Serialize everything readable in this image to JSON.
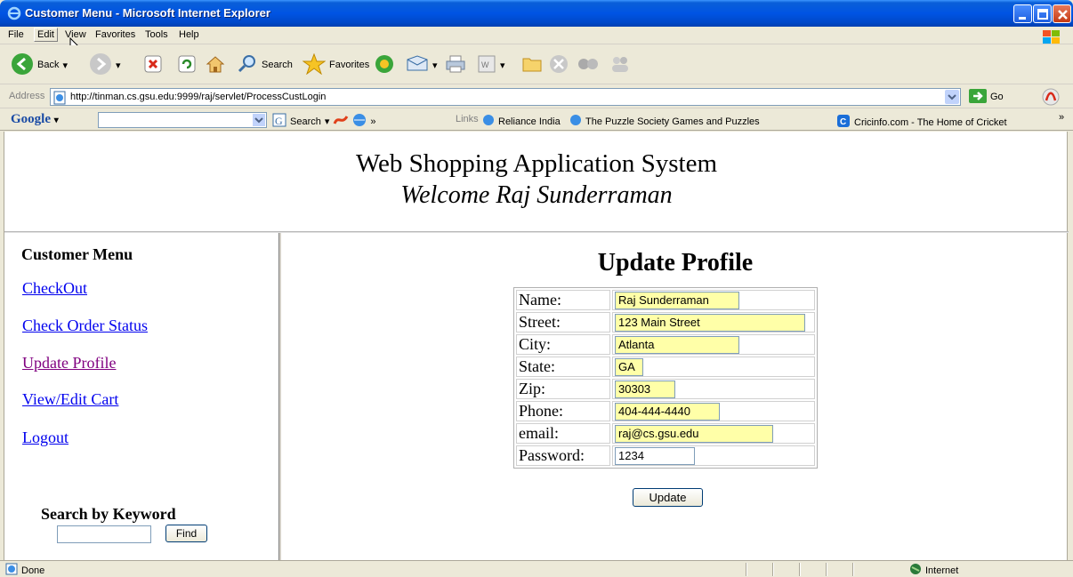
{
  "window": {
    "title": "Customer Menu - Microsoft Internet Explorer"
  },
  "menubar": {
    "items": [
      "File",
      "Edit",
      "View",
      "Favorites",
      "Tools",
      "Help"
    ]
  },
  "toolbar": {
    "back_label": "Back",
    "search_label": "Search",
    "favorites_label": "Favorites"
  },
  "address": {
    "label": "Address",
    "url": "http://tinman.cs.gsu.edu:9999/raj/servlet/ProcessCustLogin",
    "go_label": "Go"
  },
  "googlebar": {
    "logo": "Google",
    "search_label": "Search",
    "links_label": "Links",
    "links": [
      "Reliance India",
      "The Puzzle Society Games and Puzzles",
      "Cricinfo.com - The Home of Cricket"
    ]
  },
  "header": {
    "title": "Web Shopping Application System",
    "welcome": "Welcome Raj Sunderraman"
  },
  "sidebar": {
    "title": "Customer Menu",
    "links": [
      "CheckOut",
      "Check Order Status",
      "Update Profile",
      "View/Edit Cart",
      "Logout"
    ],
    "search_title": "Search by Keyword",
    "find_label": "Find"
  },
  "main": {
    "title": "Update Profile",
    "fields": [
      {
        "label": "Name:",
        "value": "Raj Sunderraman"
      },
      {
        "label": "Street:",
        "value": "123 Main Street"
      },
      {
        "label": "City:",
        "value": "Atlanta"
      },
      {
        "label": "State:",
        "value": "GA"
      },
      {
        "label": "Zip:",
        "value": "30303"
      },
      {
        "label": "Phone:",
        "value": "404-444-4440"
      },
      {
        "label": "email:",
        "value": "raj@cs.gsu.edu"
      },
      {
        "label": "Password:",
        "value": "1234"
      }
    ],
    "update_label": "Update"
  },
  "status": {
    "left": "Done",
    "zone": "Internet"
  },
  "colors": {
    "titlebar": "#0054e3",
    "link": "#0000ee",
    "visited_link": "#800080",
    "autofill": "#ffffa8"
  }
}
